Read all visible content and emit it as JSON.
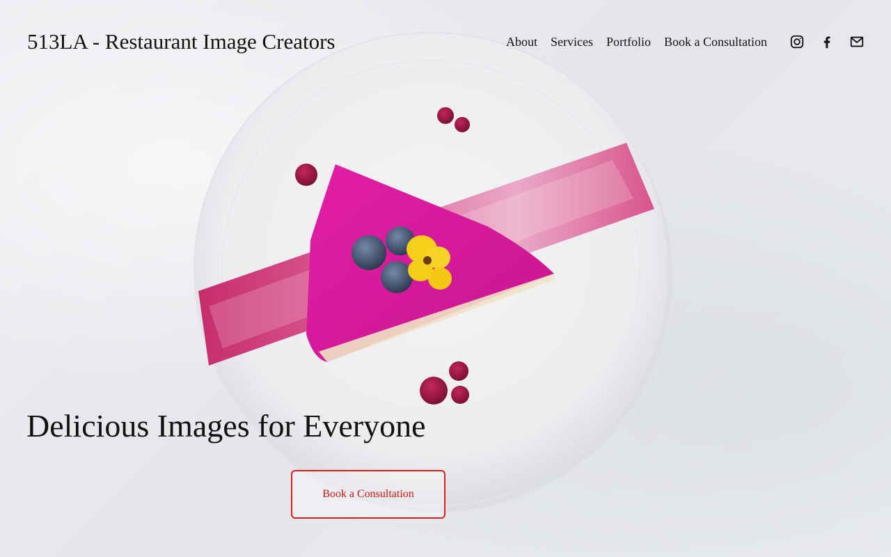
{
  "header": {
    "site_title": "513LA - Restaurant Image Creators",
    "nav": [
      {
        "label": "About"
      },
      {
        "label": "Services"
      },
      {
        "label": "Portfolio"
      },
      {
        "label": "Book a Consultation"
      }
    ],
    "social": [
      {
        "icon": "instagram-icon"
      },
      {
        "icon": "facebook-icon"
      },
      {
        "icon": "email-icon"
      }
    ]
  },
  "hero": {
    "heading": "Delicious Images for Everyone",
    "cta_label": "Book a Consultation",
    "image": "plate-with-pink-cheesecake-slice"
  },
  "colors": {
    "text": "#111111",
    "accent": "#e01b1b",
    "background": "#e8eaed",
    "cake": "#d4169a"
  }
}
